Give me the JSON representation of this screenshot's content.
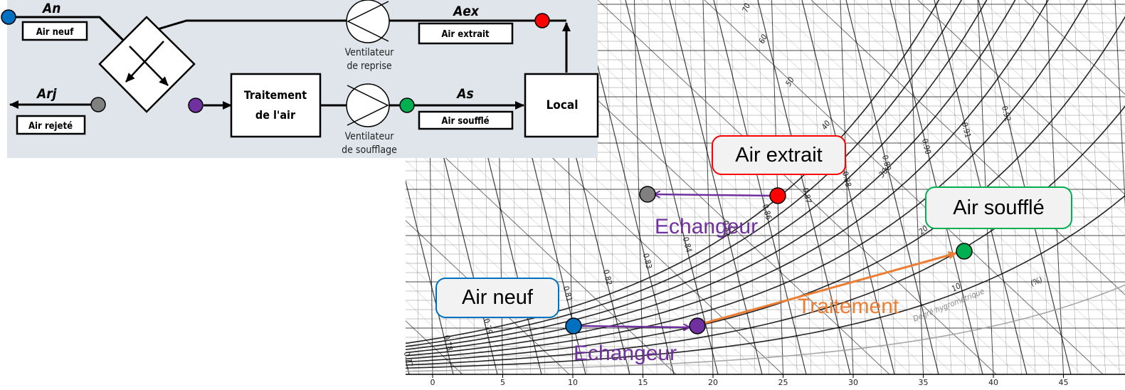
{
  "colors": {
    "air_neuf": "#0070c0",
    "air_extrait": "#ff0000",
    "air_rejete": "#808080",
    "echangeur": "#7030a0",
    "air_souffle": "#00b050",
    "traitement": "#ed7d31",
    "diagram_bg": "#dfe5eb"
  },
  "diagram": {
    "an": "An",
    "air_neuf": "Air neuf",
    "arj": "Arj",
    "air_rejete": "Air rejeté",
    "aex": "Aex",
    "air_extrait": "Air extrait",
    "as": "As",
    "air_souffle": "Air soufflé",
    "traitement_line1": "Traitement",
    "traitement_line2": "de l'air",
    "local": "Local",
    "vent_reprise_1": "Ventilateur",
    "vent_reprise_2": "de reprise",
    "vent_soufflage_1": "Ventilateur",
    "vent_soufflage_2": "de soufflage"
  },
  "chart": {
    "x_ticks": [
      "0",
      "5",
      "10",
      "15",
      "20",
      "25",
      "30",
      "35",
      "40",
      "45",
      "5"
    ],
    "rh_labels": [
      "10",
      "20",
      "30",
      "40",
      "50",
      "60",
      "70"
    ],
    "volume_labels": [
      "0.77",
      "0.78",
      "0.79",
      "0.80",
      "0.81",
      "0.82",
      "0.83",
      "0.84",
      "0.85",
      "0.86",
      "0.87",
      "0.88",
      "0.89",
      "0.90",
      "0.91",
      "0.92"
    ],
    "rh_title": "Degré hygrométrique",
    "rh_unit": "(%)",
    "callouts": {
      "air_extrait": "Air extrait",
      "air_souffle": "Air soufflé",
      "air_neuf": "Air neuf"
    },
    "processes": {
      "echangeur_top": "Echangeur",
      "echangeur_bottom": "Echangeur",
      "traitement": "Traitement"
    }
  }
}
